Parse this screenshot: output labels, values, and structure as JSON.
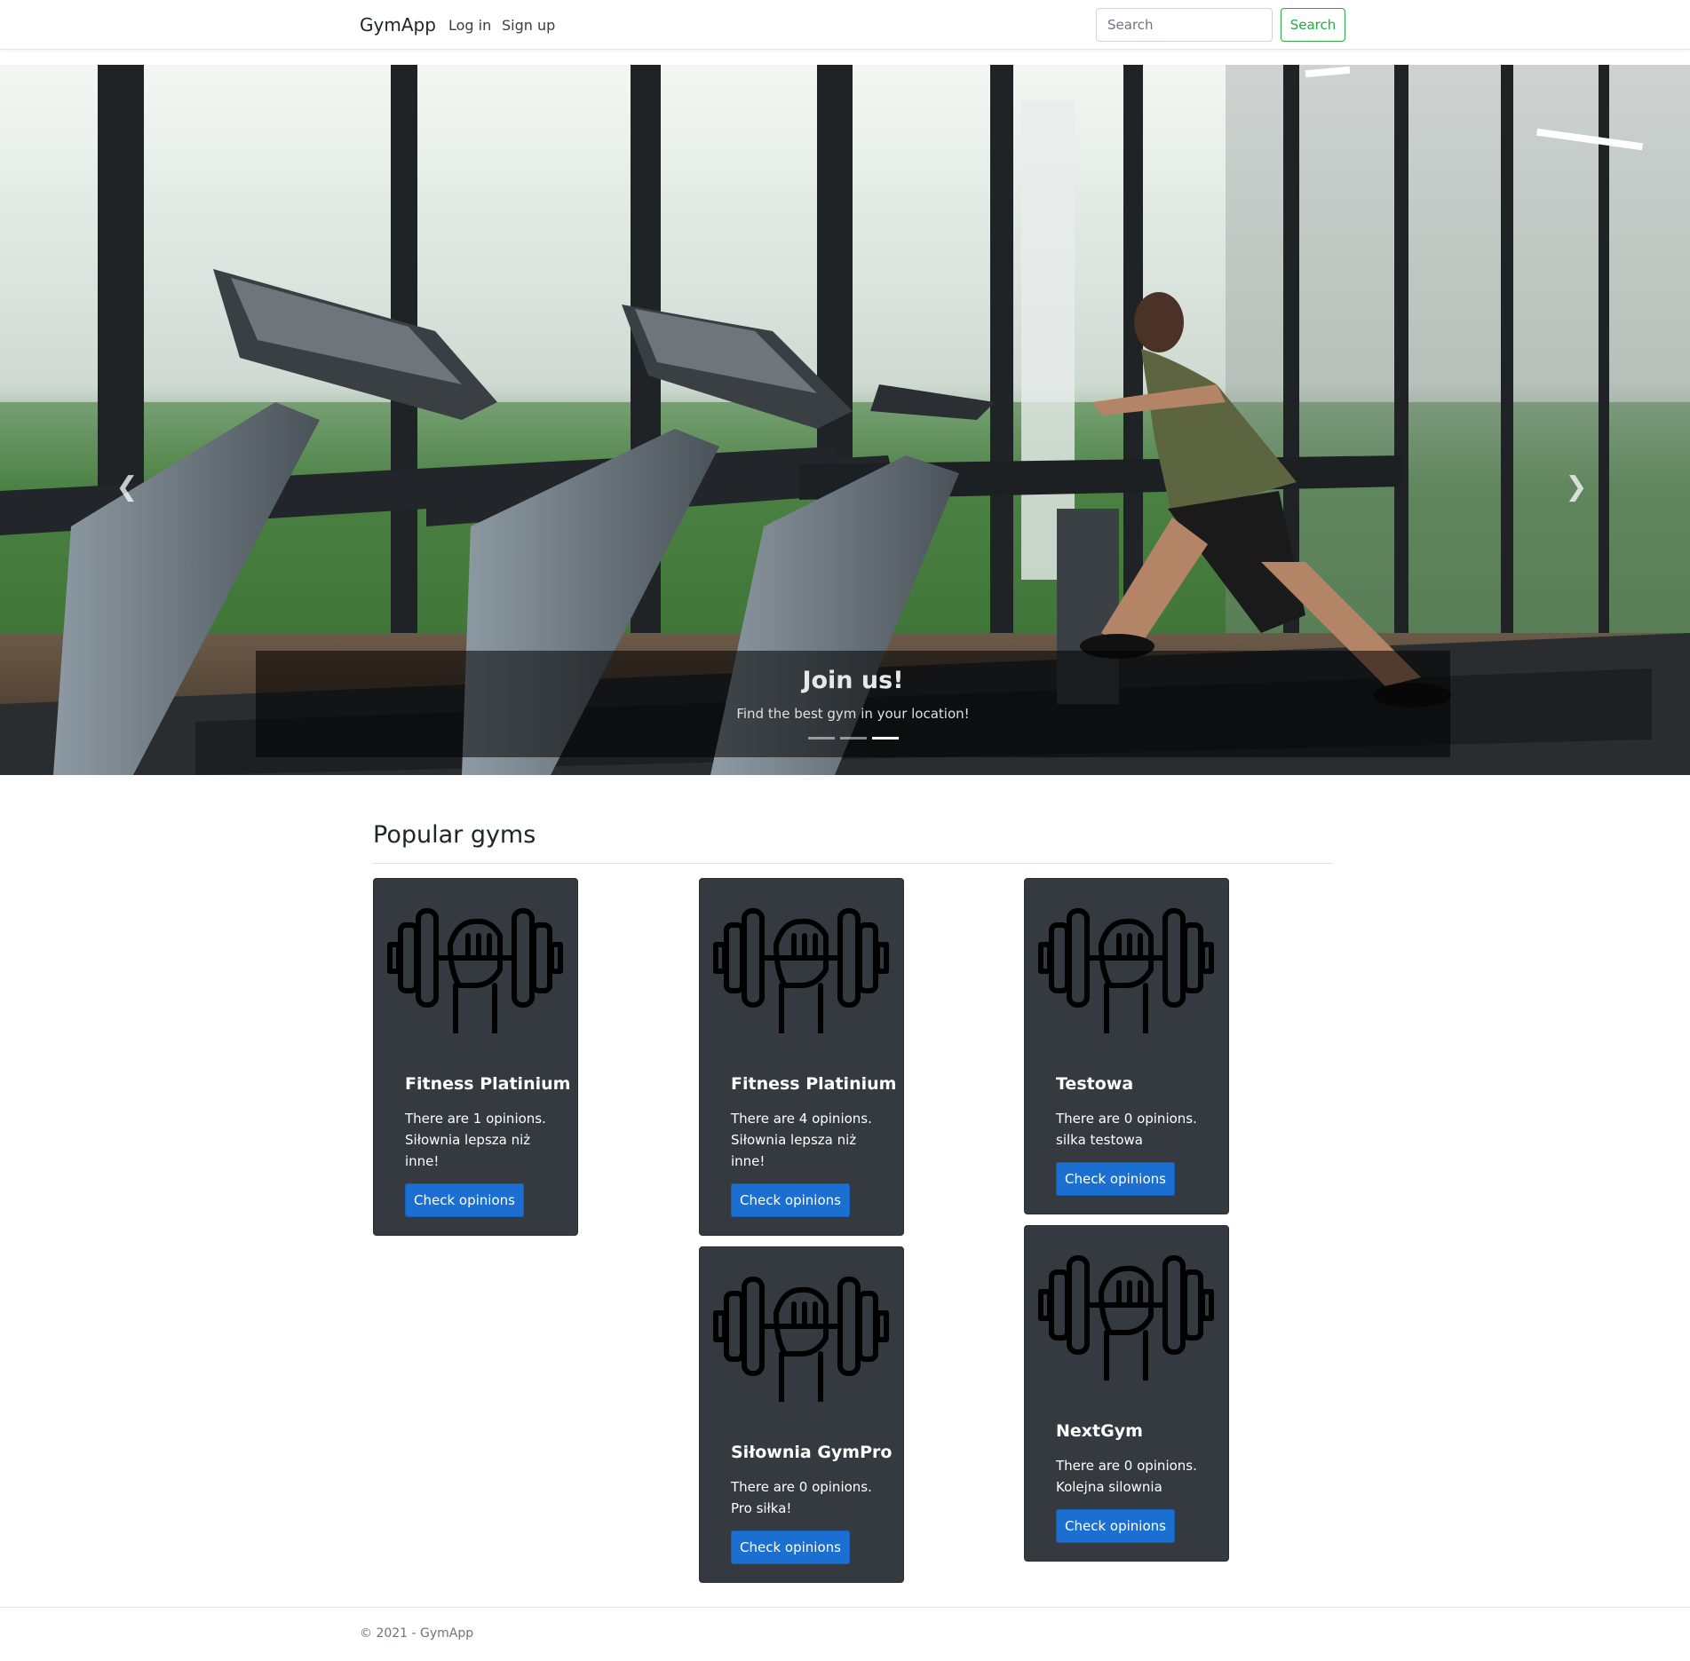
{
  "navbar": {
    "brand": "GymApp",
    "login": "Log in",
    "signup": "Sign up",
    "search_placeholder": "Search",
    "search_button": "Search"
  },
  "hero": {
    "prev_icon": "chevron-left-icon",
    "next_icon": "chevron-right-icon",
    "caption_title": "Join us!",
    "caption_text": "Find the best gym in your location!",
    "indicators": 3,
    "active_indicator": 3
  },
  "section": {
    "title": "Popular gyms"
  },
  "gyms": [
    {
      "name": "Fitness Platinium",
      "opinions": "There are 1 opinions.",
      "description": "Siłownia lepsza niż inne!",
      "button": "Check opinions"
    },
    {
      "name": "Fitness Platinium",
      "opinions": "There are 4 opinions.",
      "description": "Siłownia lepsza niż inne!",
      "button": "Check opinions"
    },
    {
      "name": "Testowa",
      "opinions": "There are 0 opinions.",
      "description": "silka testowa",
      "button": "Check opinions"
    },
    {
      "name": "Siłownia GymPro",
      "opinions": "There are 0 opinions.",
      "description": "Pro siłka!",
      "button": "Check opinions"
    },
    {
      "name": "NextGym",
      "opinions": "There are 0 opinions.",
      "description": "Kolejna silownia",
      "button": "Check opinions"
    }
  ],
  "footer": {
    "text": "© 2021 - GymApp"
  },
  "colors": {
    "card_bg": "#343a40",
    "button_primary": "#1a6fd1",
    "search_outline": "#28a745"
  }
}
